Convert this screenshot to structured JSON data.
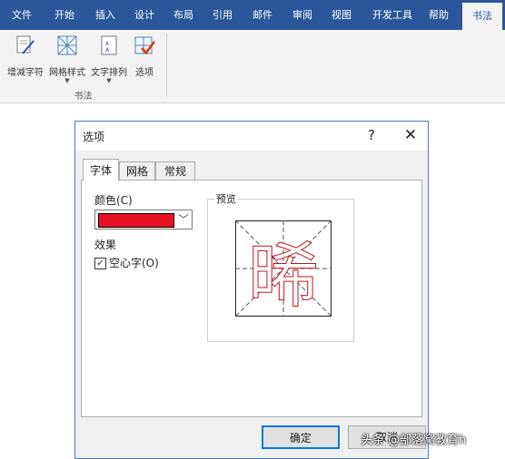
{
  "ribbon_tabs": [
    "文件",
    "开始",
    "插入",
    "设计",
    "布局",
    "引用",
    "邮件",
    "审阅",
    "视图",
    "开发工具",
    "帮助",
    "书法"
  ],
  "active_tab": "书法",
  "ribbon": {
    "buttons": [
      "增减字符",
      "网格样式",
      "文字排列",
      "选项"
    ],
    "group_label": "书法"
  },
  "dialog": {
    "title": "选项",
    "help": "?",
    "close": "✕",
    "tabs": [
      "字体",
      "网格",
      "常规"
    ],
    "color_label": "颜色(C)",
    "color_value": "#e81123",
    "effects_label": "效果",
    "hollow_checkbox": {
      "label": "空心字(O)",
      "checked": true
    },
    "preview_label": "预览",
    "preview_char": "晞",
    "ok_label": "确定",
    "cancel_label": "取消"
  },
  "watermark": "头条 @部落窝教育h",
  "colors": {
    "ribbon_blue": "#2b579a",
    "accent": "#0078d7",
    "preview_stroke": "#c0141c"
  }
}
